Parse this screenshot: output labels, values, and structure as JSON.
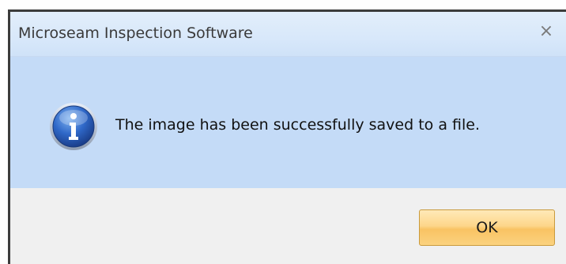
{
  "dialog": {
    "title": "Microseam Inspection Software",
    "close_glyph": "×",
    "message": "The image has been successfully saved to a file.",
    "icon": "info-icon",
    "ok_label": "OK"
  },
  "colors": {
    "content_bg": "#c4dbf7",
    "footer_bg": "#f0f0f0",
    "ok_button": "#f9c363"
  }
}
